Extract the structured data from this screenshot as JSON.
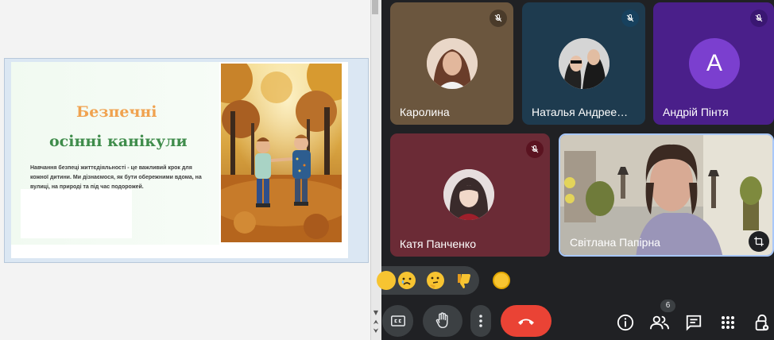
{
  "slide": {
    "title_line1": "Безпечні",
    "title_line2": "осінні канікули",
    "body": "Навчання безпеці життєдіяльності - це важливий крок для кожної дитини. Ми дізнаємося, як бути обережними вдома, на вулиці, на природі та під час подорожей."
  },
  "participants": [
    {
      "name": "Каролина",
      "muted": true
    },
    {
      "name": "Наталья Андрее…",
      "muted": true
    },
    {
      "name": "Андрій Пінтя",
      "muted": true,
      "initial": "A"
    },
    {
      "name": "Катя Панченко",
      "muted": true
    },
    {
      "name": "Світлана Папірна",
      "muted": false
    }
  ],
  "controls": {
    "people_count": "6"
  },
  "colors": {
    "end_call": "#ea4335",
    "title_orange": "#f0a24f",
    "title_green": "#3f8c4b",
    "andrii_avatar": "#7b3fcf"
  }
}
